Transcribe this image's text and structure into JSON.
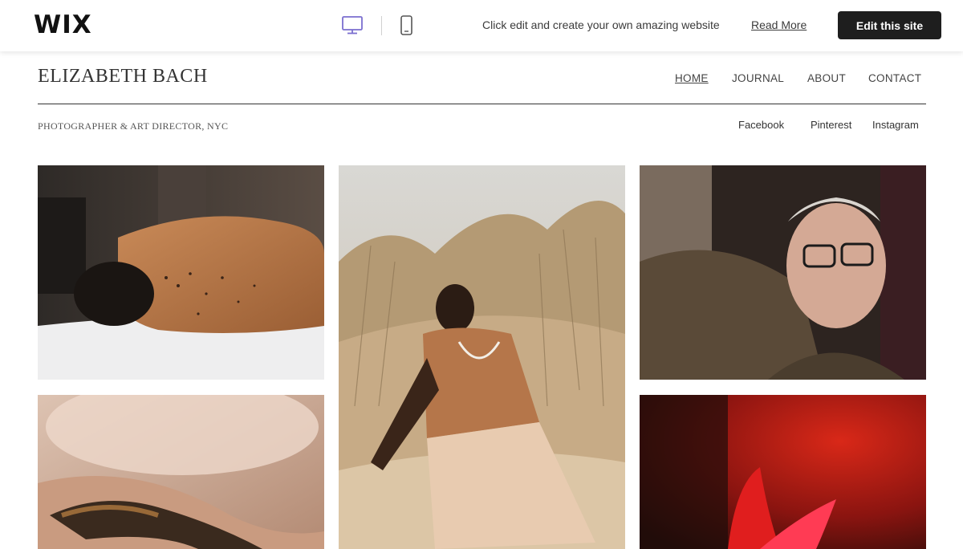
{
  "wix_bar": {
    "logo": "WIX",
    "desktop_icon": "desktop-monitor-icon",
    "mobile_icon": "mobile-phone-icon",
    "promo_text": "Click edit and create your own amazing website",
    "read_more": "Read More",
    "edit_button": "Edit this site",
    "accent_color": "#7b6fcf"
  },
  "site": {
    "title": "ELIZABETH BACH",
    "tagline": "PHOTOGRAPHER & ART DIRECTOR, NYC",
    "nav": [
      {
        "label": "HOME",
        "active": true
      },
      {
        "label": "JOURNAL",
        "active": false
      },
      {
        "label": "ABOUT",
        "active": false
      },
      {
        "label": "CONTACT",
        "active": false
      }
    ],
    "social": [
      "Facebook",
      "Pinterest",
      "Instagram"
    ]
  },
  "gallery": [
    {
      "subject": "back-tattoo-photo"
    },
    {
      "subject": "man-in-dunes-photo"
    },
    {
      "subject": "older-man-glasses-photo"
    },
    {
      "subject": "snake-on-hand-photo"
    },
    {
      "subject": "red-flower-photo"
    }
  ]
}
